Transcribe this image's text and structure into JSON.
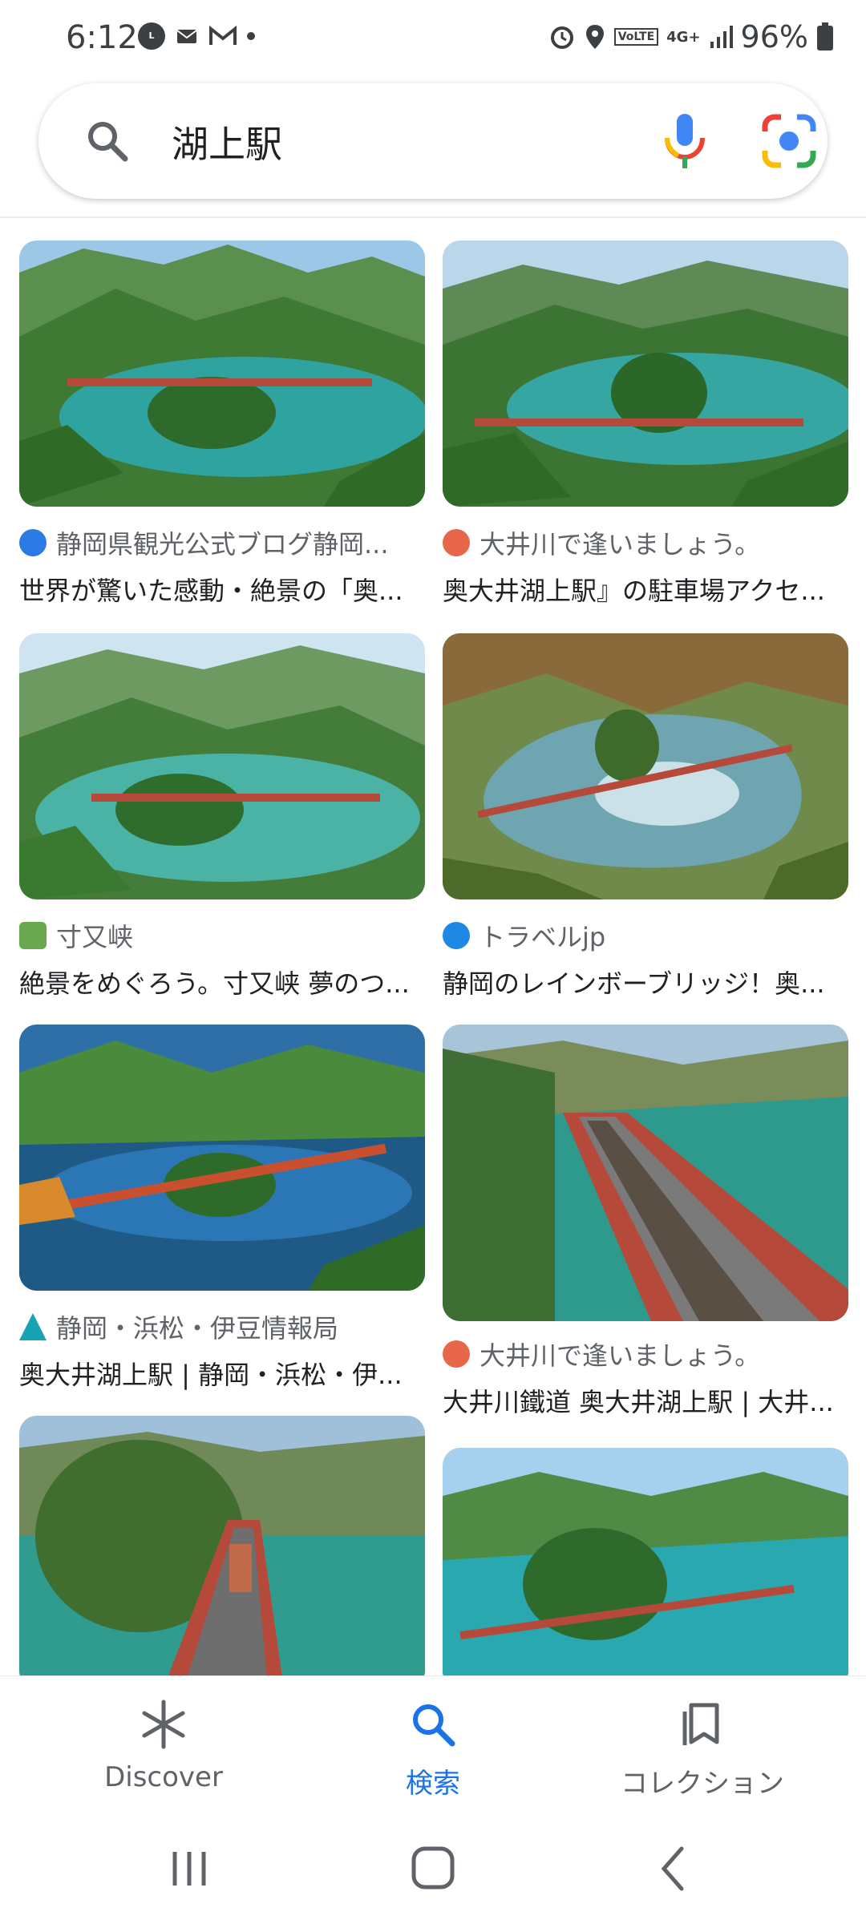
{
  "status": {
    "time": "6:12",
    "battery": "96%",
    "network": "4G+",
    "volte": "VoLTE"
  },
  "search": {
    "query": "湖上駅"
  },
  "results": [
    {
      "source": "静岡県観光公式ブログ静岡...",
      "title": "世界が驚いた感動・絶景の「奥...",
      "favicon_color": "#2c7be5"
    },
    {
      "source": "大井川で逢いましょう。",
      "title": "奥大井湖上駅』の駐車場アクセ...",
      "favicon_color": "#e8674b"
    },
    {
      "source": "寸又峡",
      "title": "絶景をめぐろう。寸又峡 夢のつ...",
      "favicon_color": "#6aa84f"
    },
    {
      "source": "トラベルjp",
      "title": "静岡のレインボーブリッジ！奥...",
      "favicon_color": "#1e88e5"
    },
    {
      "source": "静岡・浜松・伊豆情報局",
      "title": "奥大井湖上駅 | 静岡・浜松・伊...",
      "favicon_color": "#16a3b3"
    },
    {
      "source": "大井川で逢いましょう。",
      "title": "大井川鐵道 奥大井湖上駅 | 大井...",
      "favicon_color": "#e8674b"
    }
  ],
  "bottom_nav": {
    "discover": "Discover",
    "search": "検索",
    "collections": "コレクション"
  },
  "colors": {
    "accent": "#1a73e8",
    "lake": "#2fa3a0",
    "forest": "#3f7a35"
  }
}
